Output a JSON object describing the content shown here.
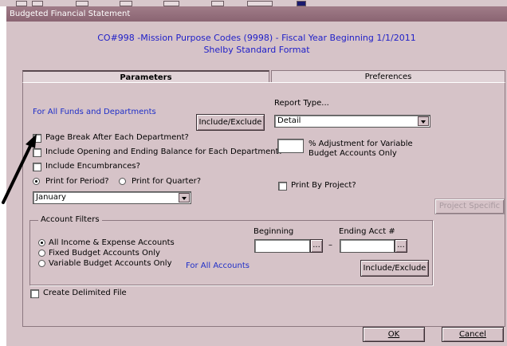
{
  "window": {
    "title": "Budgeted Financial Statement",
    "heading_line1": "CO#998 -Mission Purpose Codes (9998) - Fiscal Year Beginning 1/1/2011",
    "heading_line2": "Shelby Standard Format"
  },
  "tabs": [
    {
      "label": "Parameters",
      "active": true
    },
    {
      "label": "Preferences",
      "active": false
    }
  ],
  "parameters": {
    "funds_label": "For All Funds and Departments",
    "include_exclude_label": "Include/Exclude",
    "page_break": {
      "label": "Page Break After Each Department?",
      "checked": false
    },
    "opening_ending": {
      "label": "Include Opening and Ending Balance for Each Department?",
      "checked": false
    },
    "encumbrances": {
      "label": "Include Encumbrances?",
      "checked": false
    },
    "print_period": {
      "label": "Print for Period?",
      "selected": true
    },
    "print_quarter": {
      "label": "Print for Quarter?",
      "selected": false
    },
    "period_value": "January",
    "report_type_label": "Report Type...",
    "report_type_value": "Detail",
    "adjustment_label_1": "% Adjustment for Variable",
    "adjustment_label_2": "Budget Accounts Only",
    "adjustment_value": "",
    "print_by_project": {
      "label": "Print By Project?",
      "checked": false
    },
    "project_specific_label": "Project Specific"
  },
  "account_filters": {
    "title": "Account Filters",
    "beginning_label": "Beginning",
    "ending_label": "Ending Acct #",
    "beginning_value": "",
    "ending_value": "",
    "dash": "–",
    "browse_label": "...",
    "options": [
      {
        "label": "All Income & Expense Accounts",
        "selected": true
      },
      {
        "label": "Fixed Budget Accounts Only",
        "selected": false
      },
      {
        "label": "Variable Budget Accounts Only",
        "selected": false
      }
    ],
    "accounts_label": "For All Accounts",
    "include_exclude_label": "Include/Exclude"
  },
  "create_delimited": {
    "label": "Create Delimited File",
    "checked": false
  },
  "footer": {
    "ok_label": "OK",
    "cancel_label": "Cancel"
  },
  "colors": {
    "title_bar": "#8a6472",
    "window_bg": "#d6c3c8",
    "blue_text": "#1f2fc8",
    "arrow": "#000000"
  }
}
